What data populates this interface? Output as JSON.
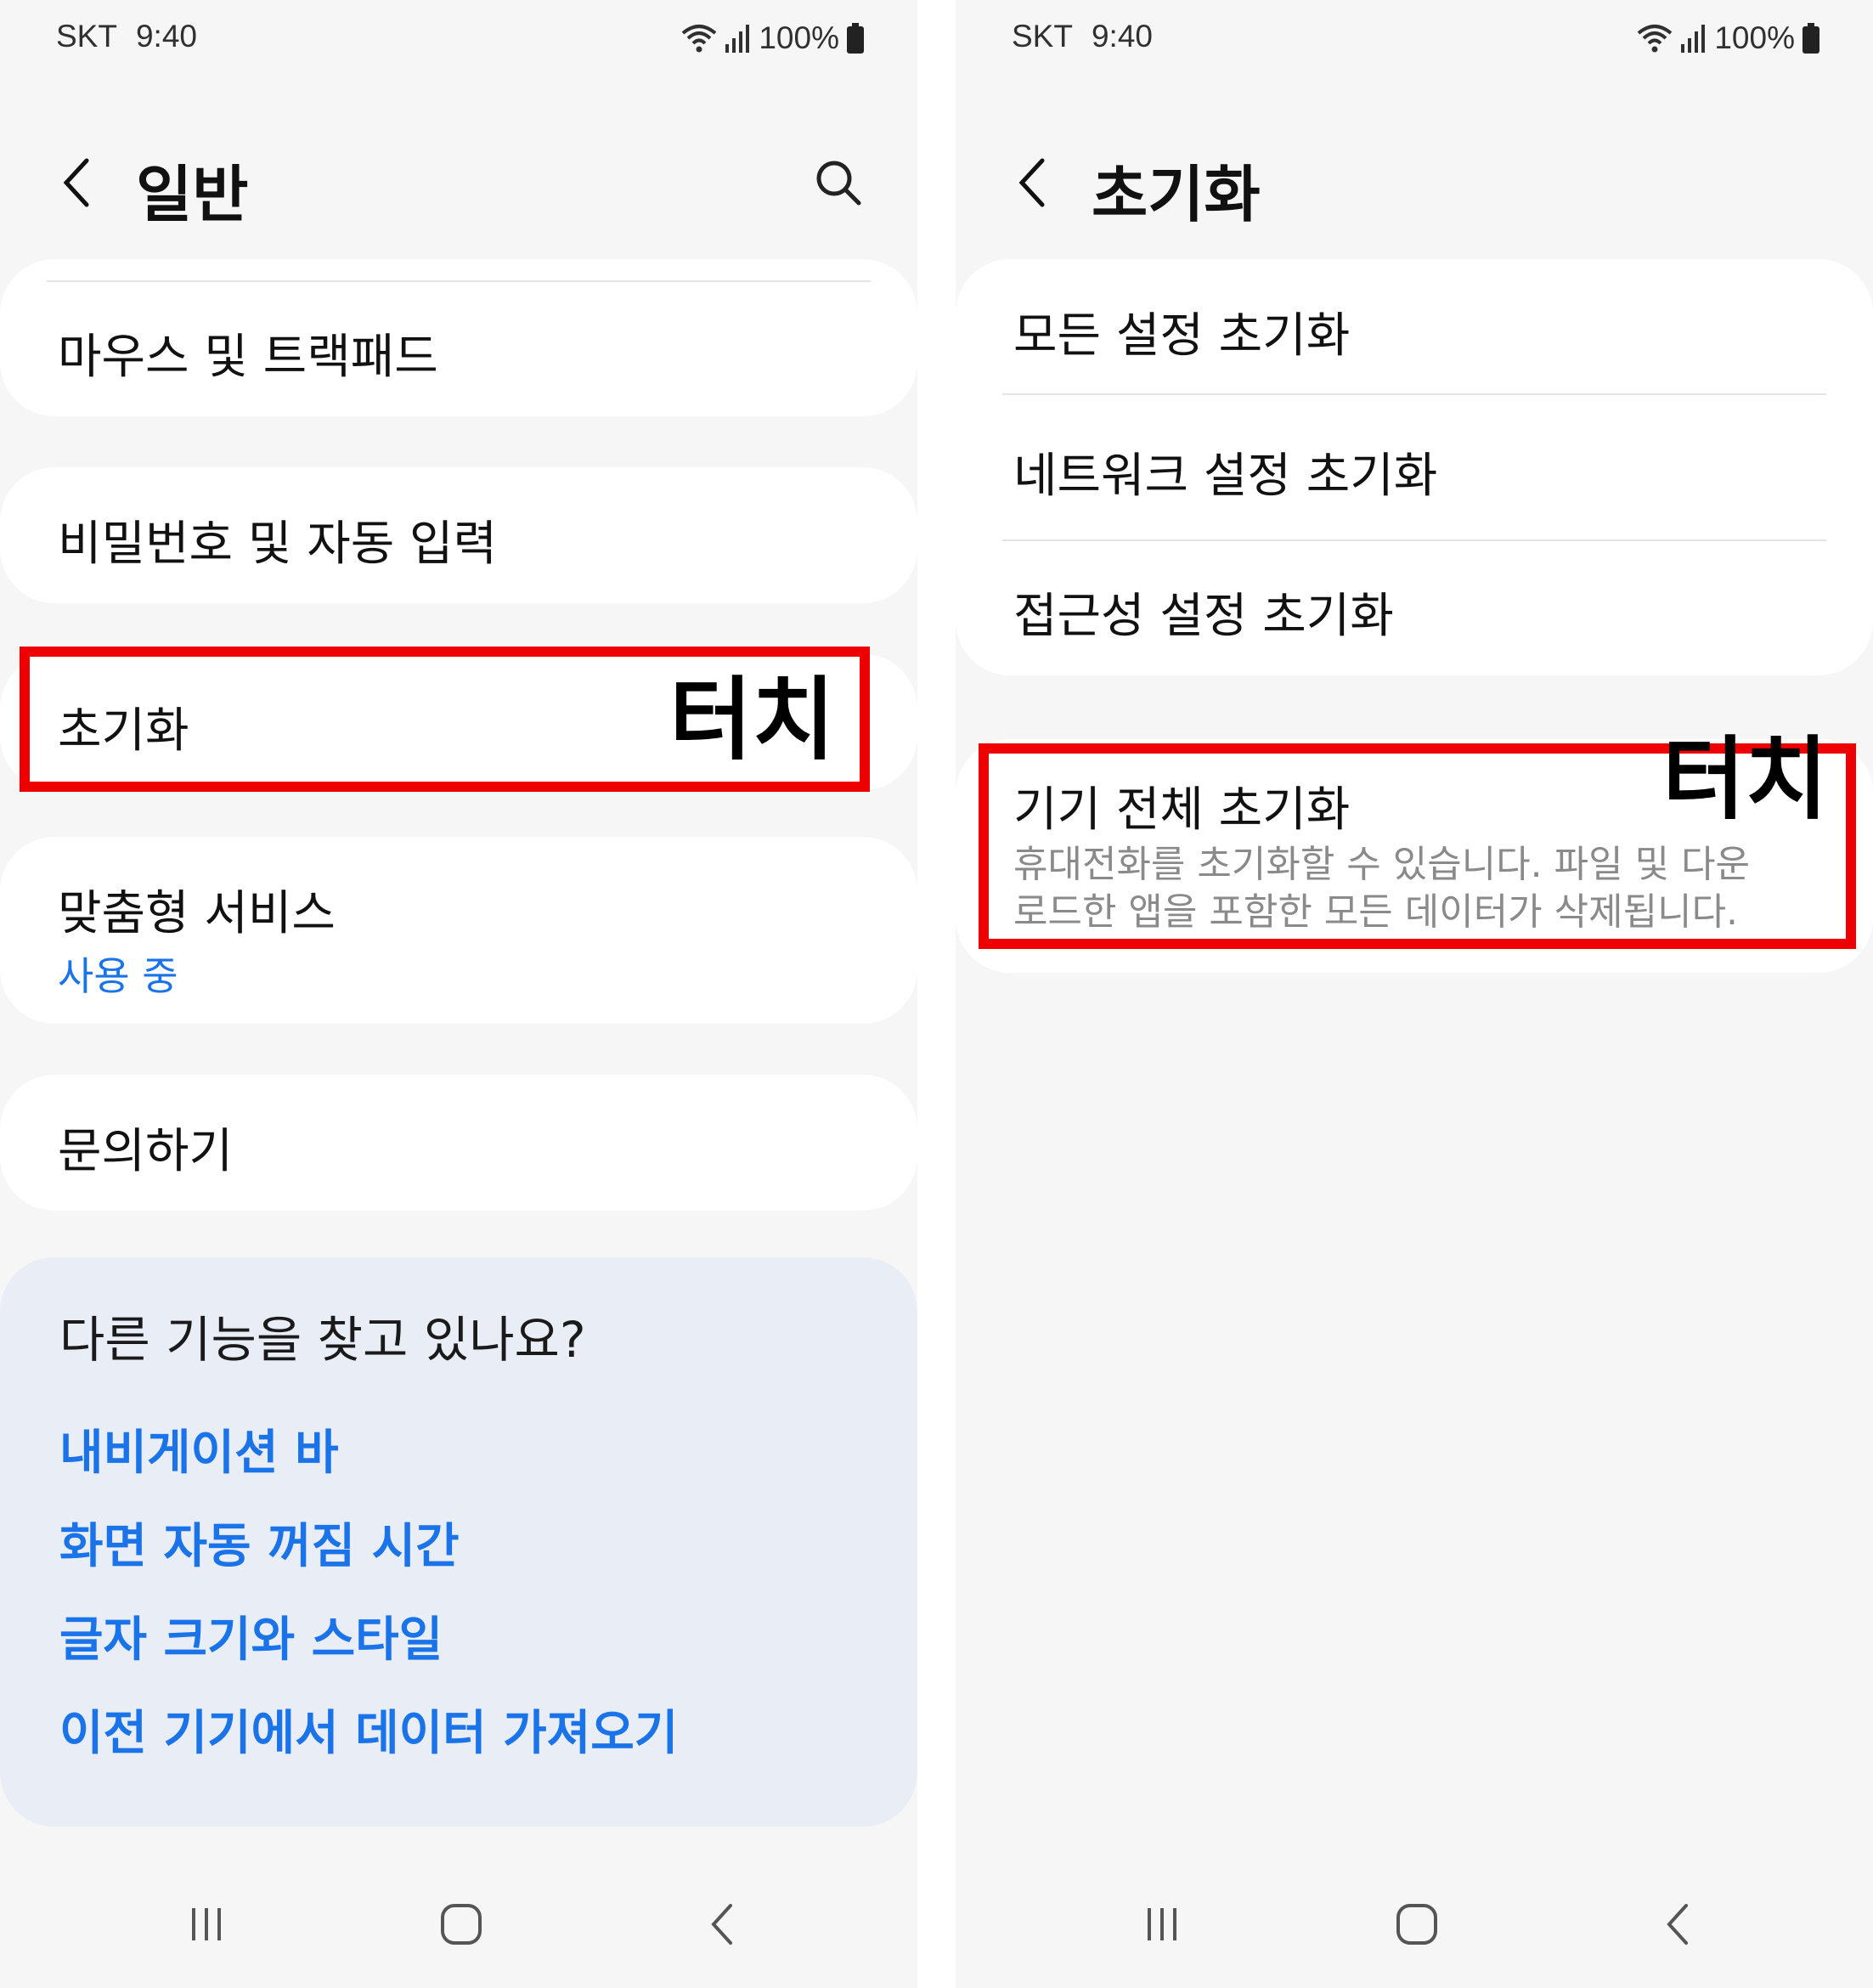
{
  "left_screen": {
    "status": {
      "carrier": "SKT",
      "time": "9:40",
      "battery": "100%"
    },
    "header": {
      "title": "일반",
      "back_icon": "chevron-left-icon",
      "search_icon": "search-icon"
    },
    "items": [
      {
        "label": "마우스 및 트랙패드"
      },
      {
        "label": "비밀번호 및 자동 입력"
      },
      {
        "label": "초기화"
      },
      {
        "label": "맞춤형 서비스",
        "sublabel": "사용 중"
      },
      {
        "label": "문의하기"
      }
    ],
    "suggestions": {
      "title": "다른 기능을 찾고 있나요?",
      "links": [
        "내비게이션 바",
        "화면 자동 꺼짐 시간",
        "글자 크기와 스타일",
        "이전 기기에서 데이터 가져오기"
      ]
    },
    "annotation": {
      "label": "터치"
    },
    "nav": {
      "recents_icon": "recents-icon",
      "home_icon": "home-icon",
      "back_icon": "back-icon"
    }
  },
  "right_screen": {
    "status": {
      "carrier": "SKT",
      "time": "9:40",
      "battery": "100%"
    },
    "header": {
      "title": "초기화",
      "back_icon": "chevron-left-icon"
    },
    "items": [
      {
        "label": "모든 설정 초기화"
      },
      {
        "label": "네트워크 설정 초기화"
      },
      {
        "label": "접근성 설정 초기화"
      }
    ],
    "factory_reset": {
      "label": "기기 전체 초기화",
      "description_line1": "휴대전화를 초기화할 수 있습니다. 파일 및 다운",
      "description_line2": "로드한 앱을 포함한 모든 데이터가 삭제됩니다."
    },
    "annotation": {
      "label": "터치"
    },
    "nav": {
      "recents_icon": "recents-icon",
      "home_icon": "home-icon",
      "back_icon": "back-icon"
    }
  },
  "colors": {
    "highlight": "#ee0000",
    "link": "#1a73e8",
    "background": "#f6f6f6",
    "suggestion_bg": "#e8edf6"
  }
}
